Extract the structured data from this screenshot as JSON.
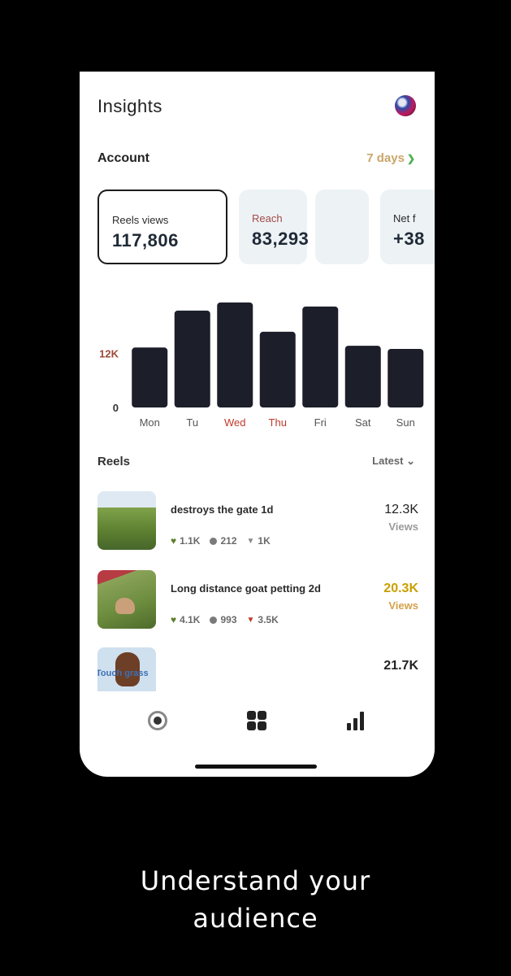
{
  "header": {
    "title": "Insights"
  },
  "account": {
    "label": "Account",
    "range": "7 days"
  },
  "metrics": [
    {
      "label": "Reels views",
      "value": "117,806"
    },
    {
      "label": "Reach",
      "value": "83,293"
    },
    {
      "label": "",
      "value": ""
    },
    {
      "label": "Net f",
      "value": "+38"
    }
  ],
  "chart_data": {
    "type": "bar",
    "categories": [
      "Mon",
      "Tu",
      "Wed",
      "Thu",
      "Fri",
      "Sat",
      "Sun"
    ],
    "values": [
      13300,
      21500,
      23300,
      16800,
      22400,
      13700,
      13000
    ],
    "ytick_labels": [
      "12K",
      "0"
    ],
    "ytick_values": [
      12000,
      0
    ],
    "ylim": [
      0,
      24000
    ],
    "bar_color": "#1c1f2a",
    "highlight_color": "#c0392b",
    "highlighted_categories": [
      "Wed",
      "Thu"
    ]
  },
  "reels": {
    "label": "Reels",
    "sort": "Latest",
    "items": [
      {
        "title": "destroys the gate 1d",
        "likes": "1.1K",
        "comments": "212",
        "shares": "1K",
        "views": "12.3K",
        "views_label": "Views"
      },
      {
        "title": "Long distance goat petting 2d",
        "likes": "4.1K",
        "comments": "993",
        "shares": "3.5K",
        "views": "20.3K",
        "views_label": "Views"
      },
      {
        "title": "",
        "likes": "",
        "comments": "",
        "shares": "",
        "views": "21.7K",
        "views_label": "",
        "thumb_text": "Touch grass"
      }
    ]
  },
  "tabs": [
    {
      "icon": "circle-dot-icon"
    },
    {
      "icon": "grid-icon"
    },
    {
      "icon": "bar-chart-icon"
    }
  ],
  "tagline": {
    "line1": "Understand your",
    "line2": "audience"
  }
}
